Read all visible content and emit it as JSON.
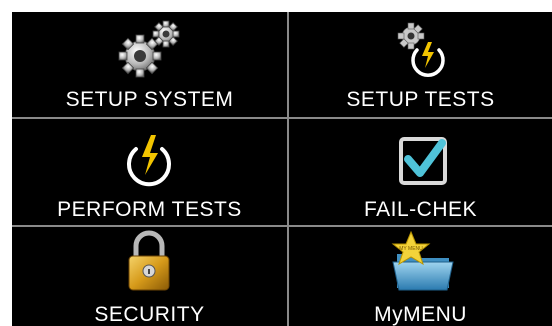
{
  "menu": {
    "tiles": [
      {
        "label": "SETUP SYSTEM",
        "icon": "gears-icon"
      },
      {
        "label": "SETUP TESTS",
        "icon": "gear-power-icon"
      },
      {
        "label": "PERFORM TESTS",
        "icon": "power-lightning-icon"
      },
      {
        "label": "FAIL-CHEK",
        "icon": "checkbox-checked-icon"
      },
      {
        "label": "SECURITY",
        "icon": "padlock-icon"
      },
      {
        "label": "MyMENU",
        "icon": "star-folder-icon"
      }
    ],
    "star_folder_text": "MY MENU"
  },
  "colors": {
    "background": "#000000",
    "text": "#ffffff",
    "divider": "#8a8a8a",
    "lightning": "#f2c400",
    "check": "#4fc3d9"
  }
}
